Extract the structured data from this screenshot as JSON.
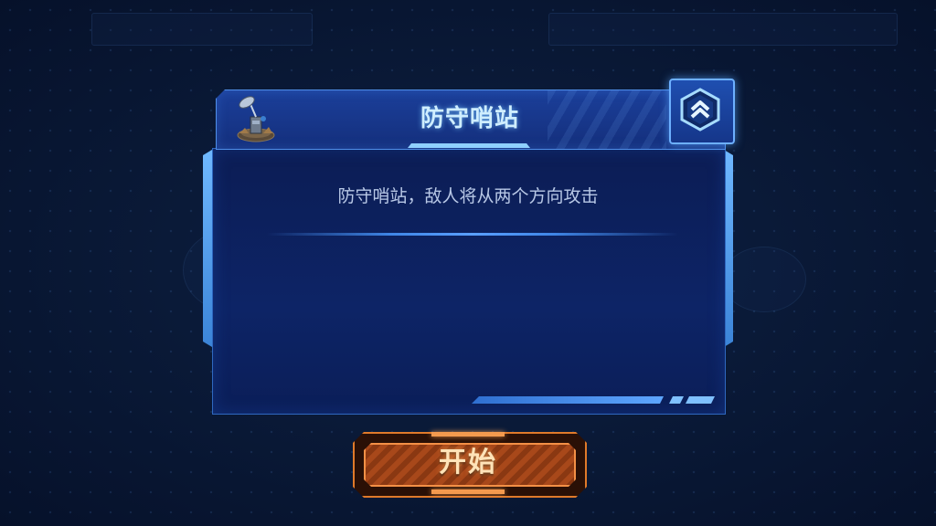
{
  "dialog": {
    "title": "防守哨站",
    "description": "防守哨站，敌人将从两个方向攻击"
  },
  "icons": {
    "stage": "radar-tower-icon",
    "rank": "chevron-rank-icon"
  },
  "start_button": {
    "label": "开始"
  },
  "colors": {
    "background": "#0a1a38",
    "panel": "#0d2466",
    "accent_blue": "#5aa0ff",
    "title_text": "#cfeeff",
    "button_orange": "#e07a2a",
    "button_text": "#ffe3b8"
  }
}
